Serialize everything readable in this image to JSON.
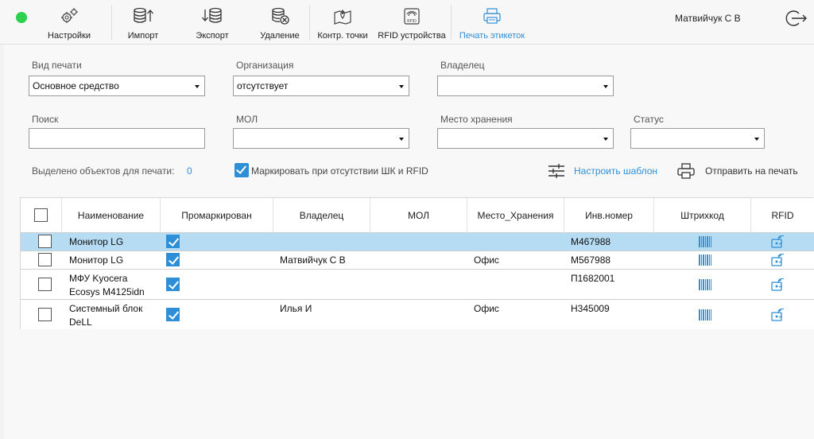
{
  "toolbar": {
    "settings": "Настройки",
    "import": "Импорт",
    "export": "Экспорт",
    "delete": "Удаление",
    "checkpoints": "Контр. точки",
    "rfid_devices": "RFID устройства",
    "print_labels": "Печать этикеток",
    "user": "Матвийчук С В",
    "status_color": "#2fcf4f"
  },
  "filters": {
    "print_type": {
      "label": "Вид печати",
      "value": "Основное средство"
    },
    "organization": {
      "label": "Организация",
      "value": "отсутствует"
    },
    "owner": {
      "label": "Владелец",
      "value": ""
    },
    "search": {
      "label": "Поиск",
      "value": ""
    },
    "mol": {
      "label": "МОЛ",
      "value": ""
    },
    "storage": {
      "label": "Место хранения",
      "value": ""
    },
    "status": {
      "label": "Статус",
      "value": ""
    }
  },
  "summary": {
    "selected_label": "Выделено объектов для печати:",
    "selected_count": "0",
    "mark_label": "Маркировать при отсутствии ШК и RFID",
    "mark_checked": true,
    "configure_template": "Настроить шаблон",
    "send_to_print": "Отправить на печать"
  },
  "table": {
    "headers": {
      "name": "Наименование",
      "marked": "Промаркирован",
      "owner": "Владелец",
      "mol": "МОЛ",
      "storage": "Место_Хранения",
      "inv": "Инв.номер",
      "barcode": "Штрихкод",
      "rfid": "RFID"
    },
    "rows": [
      {
        "name1": "Монитор LG",
        "name2": "",
        "marked": true,
        "owner": "",
        "mol": "",
        "storage": "",
        "inv": "M467988"
      },
      {
        "name1": "Монитор LG",
        "name2": "",
        "marked": true,
        "owner": "Матвийчук С В",
        "mol": "",
        "storage": "Офис",
        "inv": "M567988"
      },
      {
        "name1": "МФУ Kyocera",
        "name2": "Ecosys M4125idn",
        "marked": true,
        "owner": "",
        "mol": "",
        "storage": "",
        "inv": "П1682001"
      },
      {
        "name1": "Системный блок",
        "name2": "DeLL",
        "marked": true,
        "owner": "Илья И",
        "mol": "",
        "storage": "Офис",
        "inv": "H345009"
      }
    ]
  },
  "colors": {
    "accent": "#2e8fd6",
    "selected_row": "#b6dcf4"
  }
}
